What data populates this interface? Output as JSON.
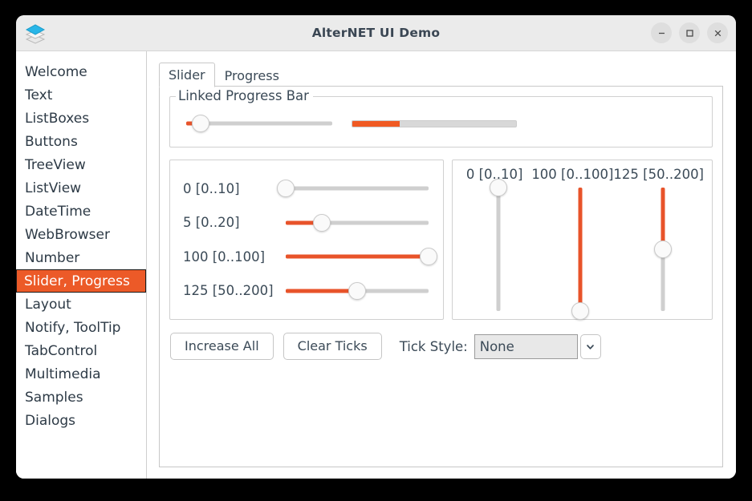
{
  "window": {
    "title": "AlterNET UI Demo",
    "icon": "layers-icon",
    "controls": {
      "minimize": "minimize-icon",
      "maximize": "maximize-icon",
      "close": "close-icon"
    }
  },
  "sidebar": {
    "items": [
      {
        "label": "Welcome",
        "selected": false
      },
      {
        "label": "Text",
        "selected": false
      },
      {
        "label": "ListBoxes",
        "selected": false
      },
      {
        "label": "Buttons",
        "selected": false
      },
      {
        "label": "TreeView",
        "selected": false
      },
      {
        "label": "ListView",
        "selected": false
      },
      {
        "label": "DateTime",
        "selected": false
      },
      {
        "label": "WebBrowser",
        "selected": false
      },
      {
        "label": "Number",
        "selected": false
      },
      {
        "label": "Slider, Progress",
        "selected": true
      },
      {
        "label": "Layout",
        "selected": false
      },
      {
        "label": "Notify, ToolTip",
        "selected": false
      },
      {
        "label": "TabControl",
        "selected": false
      },
      {
        "label": "Multimedia",
        "selected": false
      },
      {
        "label": "Samples",
        "selected": false
      },
      {
        "label": "Dialogs",
        "selected": false
      }
    ]
  },
  "tabs": [
    {
      "label": "Slider",
      "active": true
    },
    {
      "label": "Progress",
      "active": false
    }
  ],
  "linked_group": {
    "title": "Linked Progress Bar",
    "slider": {
      "value_pct": 10,
      "fill_pct": 10
    },
    "progress": {
      "value_pct": 29
    }
  },
  "horizontal_sliders": [
    {
      "label": "0 [0..10]",
      "value": 0,
      "min": 0,
      "max": 10,
      "fill_pct": 0
    },
    {
      "label": "5 [0..20]",
      "value": 5,
      "min": 0,
      "max": 20,
      "fill_pct": 25
    },
    {
      "label": "100 [0..100]",
      "value": 100,
      "min": 0,
      "max": 100,
      "fill_pct": 100
    },
    {
      "label": "125 [50..200]",
      "value": 125,
      "min": 50,
      "max": 200,
      "fill_pct": 50
    }
  ],
  "vertical_sliders": [
    {
      "label": "0 [0..10]",
      "value": 0,
      "min": 0,
      "max": 10,
      "fill_pct": 0
    },
    {
      "label": "100 [0..100]",
      "value": 100,
      "min": 0,
      "max": 100,
      "fill_pct": 100
    },
    {
      "label": "125 [50..200]",
      "value": 125,
      "min": 50,
      "max": 200,
      "fill_pct": 50
    }
  ],
  "controls": {
    "increase_all": "Increase All",
    "clear_ticks": "Clear Ticks",
    "tick_style_label": "Tick Style:",
    "tick_style_value": "None"
  },
  "colors": {
    "accent": "#e8532a",
    "progress": "#f05a23",
    "selection": "#ec5a28",
    "track": "#cfcfcf",
    "text": "#3b4a57"
  }
}
